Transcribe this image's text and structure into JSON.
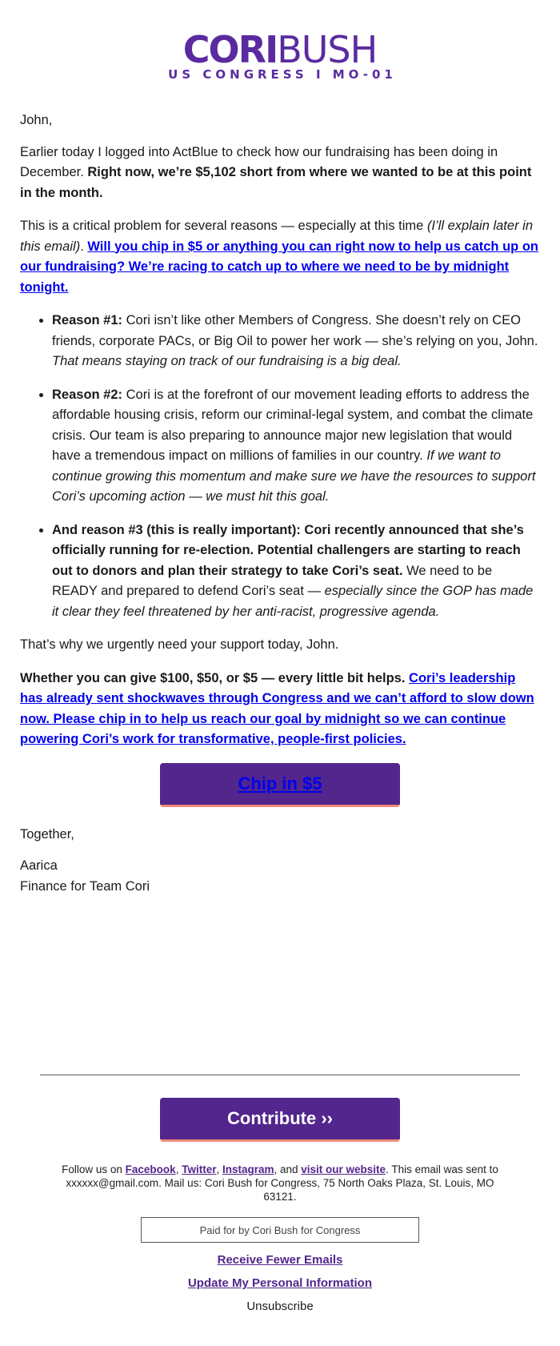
{
  "header": {
    "logo_part1": "CORI",
    "logo_part2": "BUSH",
    "logo_subtitle": "US CONGRESS I MO-01"
  },
  "colors": {
    "brand_purple": "#52268c",
    "logo_purple": "#5a2ba0",
    "link_blue": "#0000ee",
    "button_underline": "#f28b7a"
  },
  "body": {
    "greeting": "John,",
    "p1_normal": "Earlier today I logged into ActBlue to check how our fundraising has been doing in December. ",
    "p1_bold": "Right now, we’re $5,102 short from where we wanted to be at this point in the month.",
    "p2_normal": "This is a critical problem for several reasons — especially at this time ",
    "p2_italic": "(I’ll explain later in this email)",
    "p2_sep": ". ",
    "p2_link": "Will you chip in $5 or anything you can right now to help us catch up on our fundraising? We’re racing to catch up to where we need to be by midnight tonight.",
    "reasons": [
      {
        "bold": "Reason #1:",
        "normal": " Cori isn’t like other Members of Congress. She doesn’t rely on CEO friends, corporate PACs, or Big Oil to power her work — she’s relying on you, John. ",
        "italic": "That means staying on track of our fundraising is a big deal."
      },
      {
        "bold": "Reason #2:",
        "normal": " Cori is at the forefront of our movement leading efforts to address the affordable housing crisis, reform our criminal-legal system, and combat the climate crisis. Our team is also preparing to announce major new legislation that would have a tremendous impact on millions of families in our country. ",
        "italic": "If we want to continue growing this momentum and make sure we have the resources to support Cori’s upcoming action — we must hit this goal."
      },
      {
        "bold": "And reason #3 (this is really important): Cori recently announced that she’s officially running for re-election. Potential challengers are starting to reach out to donors and plan their strategy to take Cori’s seat.",
        "normal": " We need to be READY and prepared to defend Cori’s seat — ",
        "italic": "especially since the GOP has made it clear they feel threatened by her anti-racist, progressive agenda."
      }
    ],
    "p3": "That’s why we urgently need your support today, John.",
    "p4_bold": "Whether you can give $100, $50, or $5 — every little bit helps.",
    "p4_link": "Cori’s leadership has already sent shockwaves through Congress and we can’t afford to slow down now. Please chip in to help us reach our goal by midnight so we can continue powering Cori’s work for transformative, people-first policies.",
    "chip_button": "Chip in $5",
    "closing": "Together,",
    "sender_name": "Aarica",
    "sender_title": "Finance for Team Cori"
  },
  "footer": {
    "contribute_button": "Contribute ››",
    "follow_prefix": "Follow us on ",
    "facebook": "Facebook",
    "comma1": ", ",
    "twitter": "Twitter",
    "comma2": ", ",
    "instagram": "Instagram",
    "and": ", and ",
    "website": "visit our website",
    "sent_to": ". This email was sent to xxxxxx@gmail.com. Mail us: Cori Bush for Congress, 75 North Oaks Plaza, St. Louis, MO 63121.",
    "paid_for": "Paid for by Cori Bush for Congress",
    "receive_fewer": "Receive Fewer Emails",
    "update_info": "Update My Personal Information",
    "unsubscribe": "Unsubscribe"
  }
}
